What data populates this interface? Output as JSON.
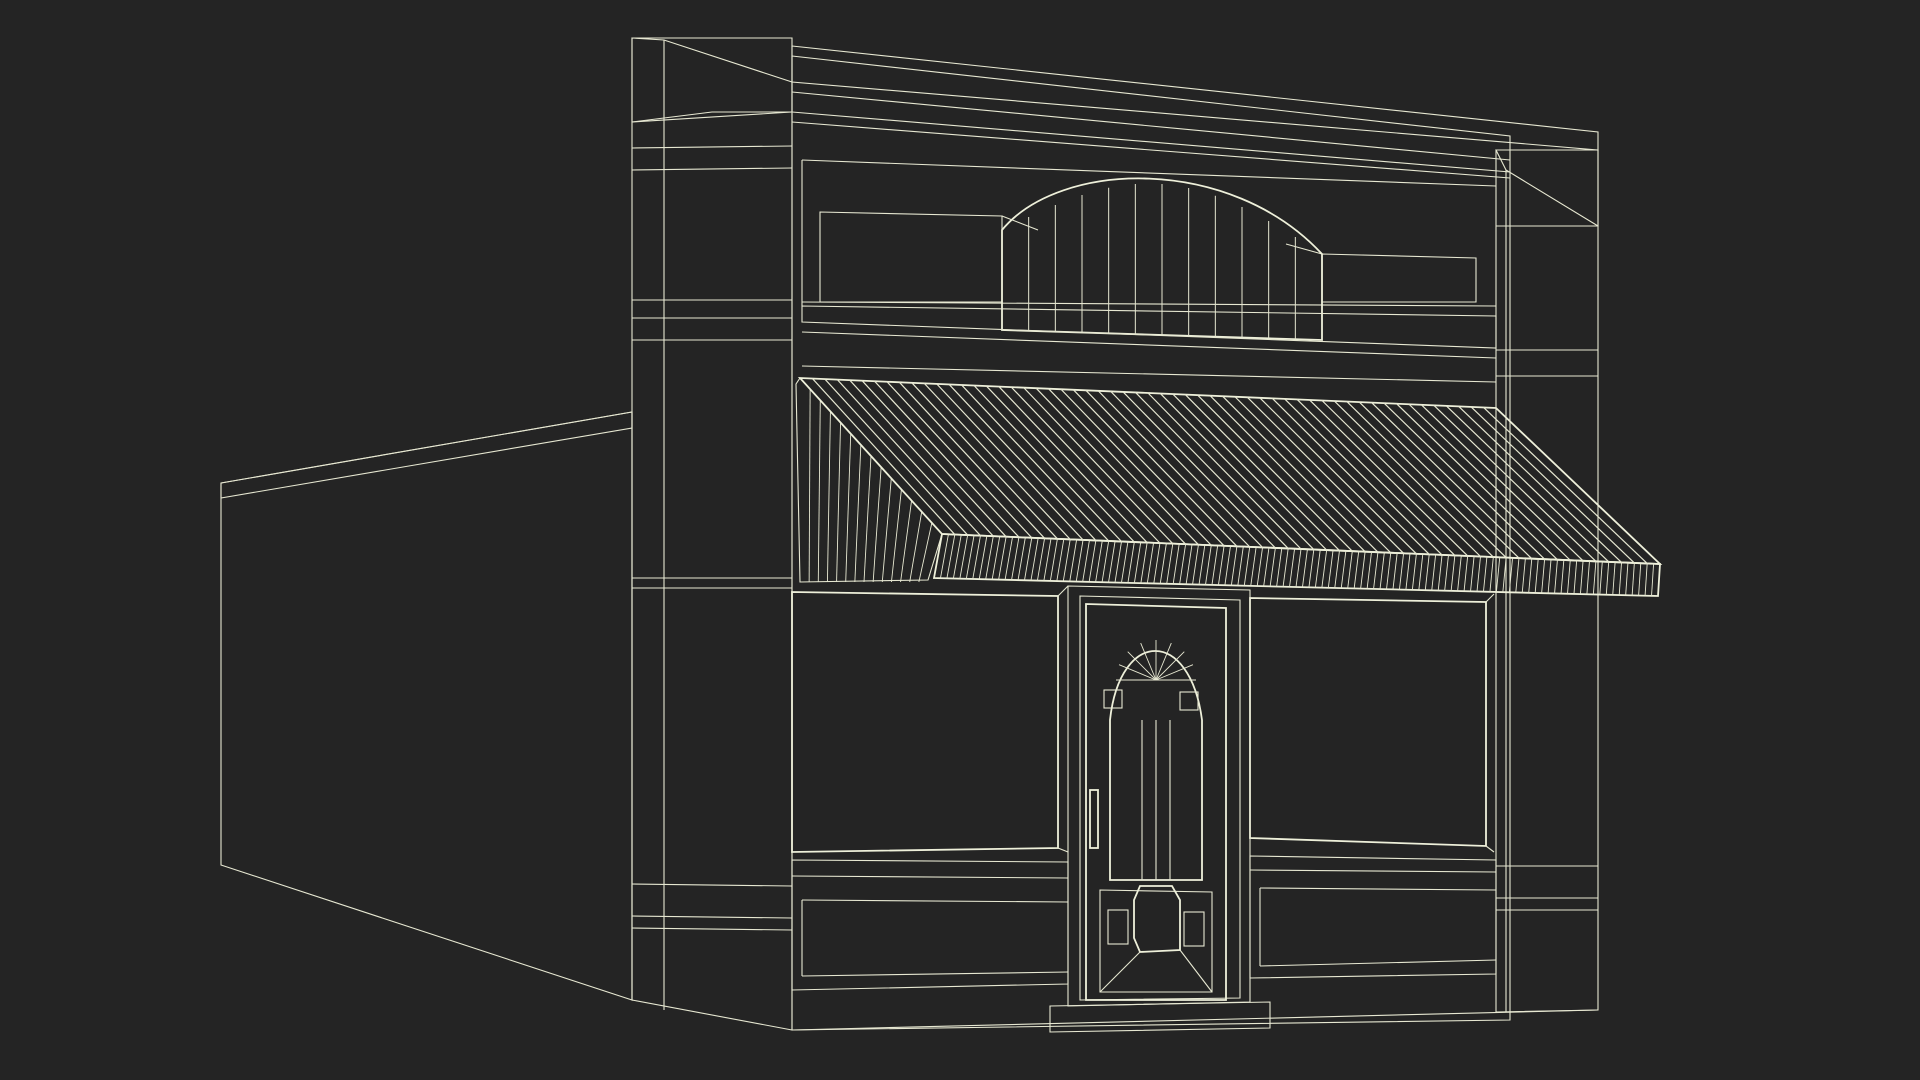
{
  "scene": {
    "subject": "storefront-building-wireframe",
    "colors": {
      "background": "#242424",
      "surface": "#7b7c6b",
      "surface_dark": "#737463",
      "surface_light": "#85867a",
      "wireframe": "#e7e8d2"
    },
    "awning_stripe_count": 56,
    "arch_panel_count": 12
  }
}
